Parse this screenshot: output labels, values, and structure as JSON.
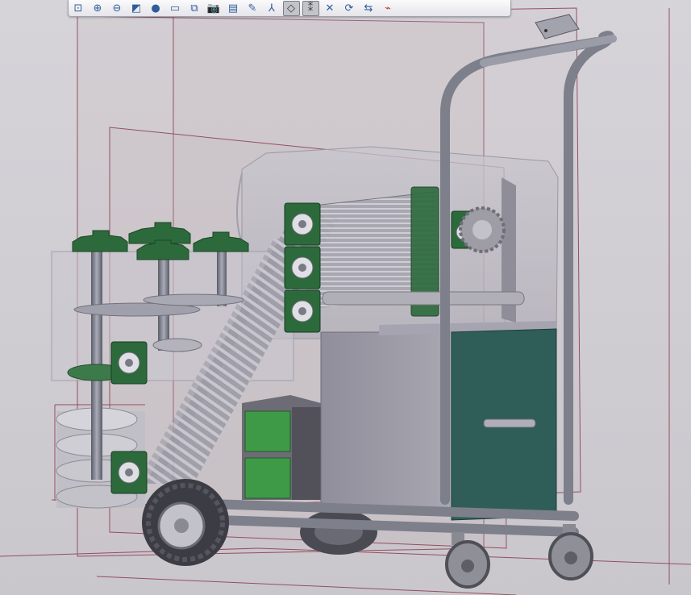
{
  "window": {
    "title": ""
  },
  "toolbar": {
    "buttons": [
      {
        "name": "zoom-fit-icon",
        "glyph": "⊡",
        "active": false
      },
      {
        "name": "zoom-in-icon",
        "glyph": "⊕",
        "active": false
      },
      {
        "name": "zoom-out-icon",
        "glyph": "⊖",
        "active": false
      },
      {
        "name": "repaint-icon",
        "glyph": "◩",
        "active": false
      },
      {
        "name": "shading-icon",
        "glyph": "●",
        "active": false
      },
      {
        "name": "view-orient-icon",
        "glyph": "▭",
        "active": false
      },
      {
        "name": "saved-views-icon",
        "glyph": "⧉",
        "active": false
      },
      {
        "name": "screenshot-icon",
        "glyph": "📷",
        "active": false
      },
      {
        "name": "layer-icon",
        "glyph": "▤",
        "active": false
      },
      {
        "name": "sketch-icon",
        "glyph": "✎",
        "active": false
      },
      {
        "name": "datum-axes-icon",
        "glyph": "⅄",
        "active": false
      },
      {
        "name": "datum-planes-icon",
        "glyph": "◇",
        "active": true
      },
      {
        "name": "datum-points-icon",
        "glyph": "⁑",
        "active": true
      },
      {
        "name": "csys-icon",
        "glyph": "✕",
        "active": false
      },
      {
        "name": "spin-center-icon",
        "glyph": "⟳",
        "active": false
      },
      {
        "name": "annotation-icon",
        "glyph": "⇆",
        "active": false
      },
      {
        "name": "display-style-icon",
        "glyph": "⌁",
        "active": false
      }
    ]
  },
  "colors": {
    "frame": "#7d7f8a",
    "bearing": "#2c6a3c",
    "housing_glass": "#b6b4be",
    "plane_lines": "#8a3a4e",
    "tank_teal": "#2f5e58",
    "bin_green": "#3f9a48"
  }
}
